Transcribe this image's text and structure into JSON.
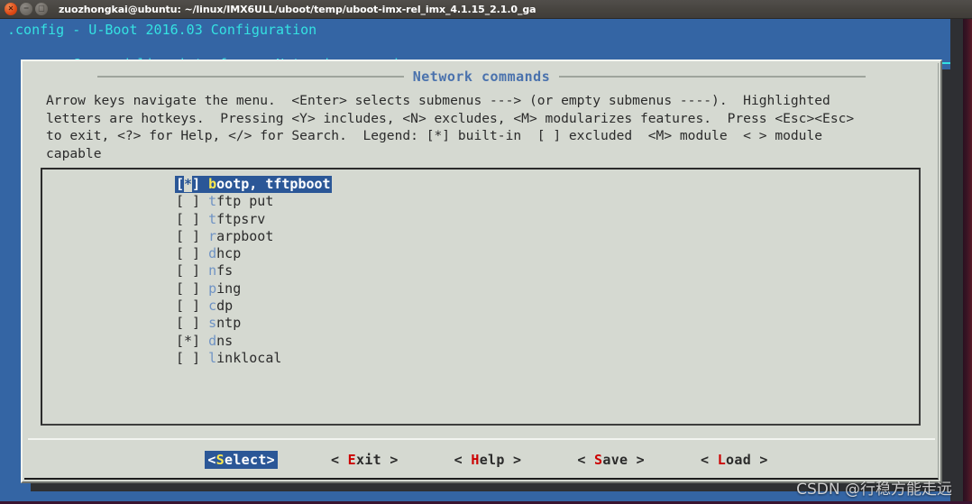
{
  "window": {
    "title": "zuozhongkai@ubuntu: ~/linux/IMX6ULL/uboot/temp/uboot-imx-rel_imx_4.1.15_2.1.0_ga",
    "close_glyph": "×",
    "minimize_glyph": "−",
    "maximize_glyph": "□",
    "colors": {
      "titlebar": "#47443f",
      "terminal_background": "#3465a4",
      "header_text": "#34e2e2",
      "dialog_background": "#d5d9d1",
      "highlight": "#2b5797",
      "hotkey_list": "#6f93c4",
      "hotkey_button": "#cc0000",
      "hotkey_selected": "#fce94f",
      "dialog_title": "#4a72ad"
    }
  },
  "header": {
    "line1": ".config - U-Boot 2016.03 Configuration",
    "line2": "→ Command line interface → Network commands"
  },
  "dialog": {
    "title": "Network commands",
    "help_text": "Arrow keys navigate the menu.  <Enter> selects submenus ---> (or empty submenus ----).  Highlighted\nletters are hotkeys.  Pressing <Y> includes, <N> excludes, <M> modularizes features.  Press <Esc><Esc>\nto exit, <?> for Help, </> for Search.  Legend: [*] built-in  [ ] excluded  <M> module  < > module\ncapable"
  },
  "menu": {
    "items": [
      {
        "mark": "[*]",
        "hotkey": "b",
        "rest": "ootp, tftpboot",
        "selected": true,
        "checked": true
      },
      {
        "mark": "[ ]",
        "hotkey": "t",
        "rest": "ftp put",
        "selected": false,
        "checked": false
      },
      {
        "mark": "[ ]",
        "hotkey": "t",
        "rest": "ftpsrv",
        "selected": false,
        "checked": false
      },
      {
        "mark": "[ ]",
        "hotkey": "r",
        "rest": "arpboot",
        "selected": false,
        "checked": false
      },
      {
        "mark": "[ ]",
        "hotkey": "d",
        "rest": "hcp",
        "selected": false,
        "checked": false
      },
      {
        "mark": "[ ]",
        "hotkey": "n",
        "rest": "fs",
        "selected": false,
        "checked": false
      },
      {
        "mark": "[ ]",
        "hotkey": "p",
        "rest": "ing",
        "selected": false,
        "checked": false
      },
      {
        "mark": "[ ]",
        "hotkey": "c",
        "rest": "dp",
        "selected": false,
        "checked": false
      },
      {
        "mark": "[ ]",
        "hotkey": "s",
        "rest": "ntp",
        "selected": false,
        "checked": false
      },
      {
        "mark": "[*]",
        "hotkey": "d",
        "rest": "ns",
        "selected": false,
        "checked": true
      },
      {
        "mark": "[ ]",
        "hotkey": "l",
        "rest": "inklocal",
        "selected": false,
        "checked": false
      }
    ]
  },
  "buttons": [
    {
      "pre": "<",
      "hotkey": "S",
      "post": "elect>",
      "selected": true
    },
    {
      "pre": "< ",
      "hotkey": "E",
      "post": "xit >",
      "selected": false
    },
    {
      "pre": "< ",
      "hotkey": "H",
      "post": "elp >",
      "selected": false
    },
    {
      "pre": "< ",
      "hotkey": "S",
      "post": "ave >",
      "selected": false
    },
    {
      "pre": "< ",
      "hotkey": "L",
      "post": "oad >",
      "selected": false
    }
  ],
  "watermark": "CSDN @行稳方能走远"
}
